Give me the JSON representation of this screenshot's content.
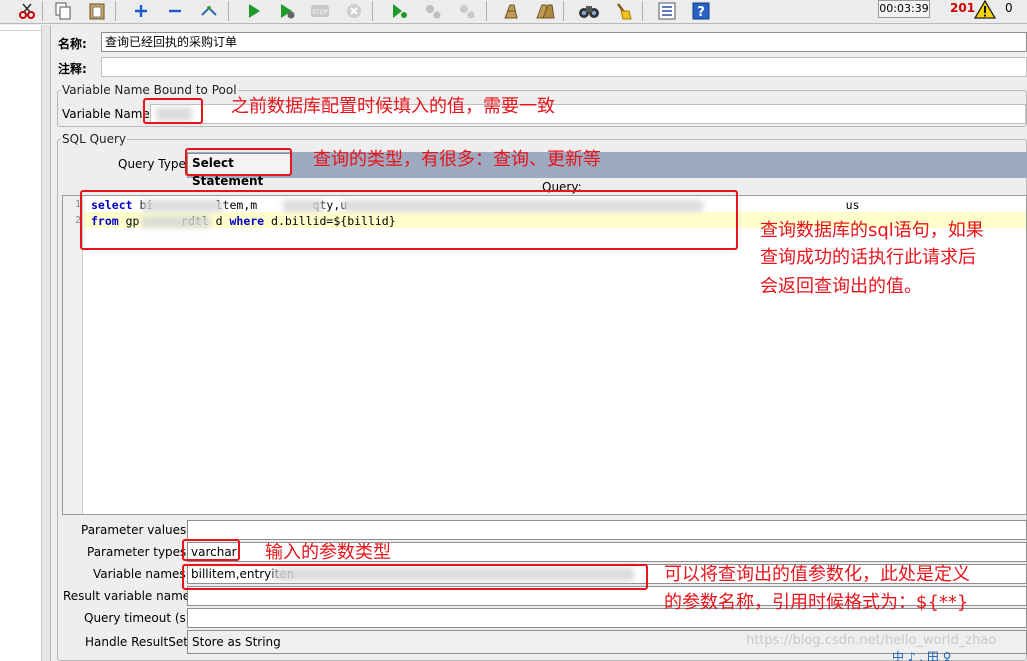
{
  "toolbar": {
    "timer": "00:03:39",
    "error_count": "201",
    "total_count": "0"
  },
  "form": {
    "name_label": "名称:",
    "name_value": "查询已经回执的采购订单",
    "comment_label": "注释:",
    "comment_value": ""
  },
  "pool_group": {
    "legend": "Variable Name Bound to Pool",
    "variable_name_label": "Variable Name:",
    "variable_name_value": ""
  },
  "sql_group": {
    "legend": "SQL Query",
    "query_type_label": "Query Type:",
    "query_type_value": "Select Statement",
    "query_label": "Query:",
    "line_numbers": [
      "1",
      "2"
    ],
    "code_line1_kw": "select",
    "code_line1_rest": " bi         ltem,m        qty,u                                                                        us",
    "code_line2_kw_from": "from",
    "code_line2_mid": " gp      rdtl d ",
    "code_line2_kw_where": "where",
    "code_line2_rest": " d.billid=${billid}"
  },
  "params": {
    "parameter_values_label": "Parameter values:",
    "parameter_values_value": "",
    "parameter_types_label": "Parameter types:",
    "parameter_types_value": "varchar",
    "variable_names_label": "Variable names:",
    "variable_names_value": "billitem,entryiten",
    "result_variable_label": "Result variable name:",
    "result_variable_value": "",
    "query_timeout_label": "Query timeout (s):",
    "query_timeout_value": "",
    "handle_resultset_label": "Handle ResultSet:",
    "handle_resultset_value": "Store as String"
  },
  "annotations": {
    "pool_note": "之前数据库配置时候填入的值，需要一致",
    "query_type_note": "查询的类型，有很多：查询、更新等",
    "sql_note_line1": "查询数据库的sql语句，如果",
    "sql_note_line2": "查询成功的话执行此请求后",
    "sql_note_line3": "会返回查询出的值。",
    "param_type_note": "输入的参数类型",
    "var_names_note_line1": "可以将查询出的值参数化，此处是定义",
    "var_names_note_line2": "的参数名称，引用时候格式为：${**}"
  },
  "watermark": "https://blog.csdn.net/hello_world_zhao",
  "ime_bar": "中 ♪ , 田 ♀"
}
